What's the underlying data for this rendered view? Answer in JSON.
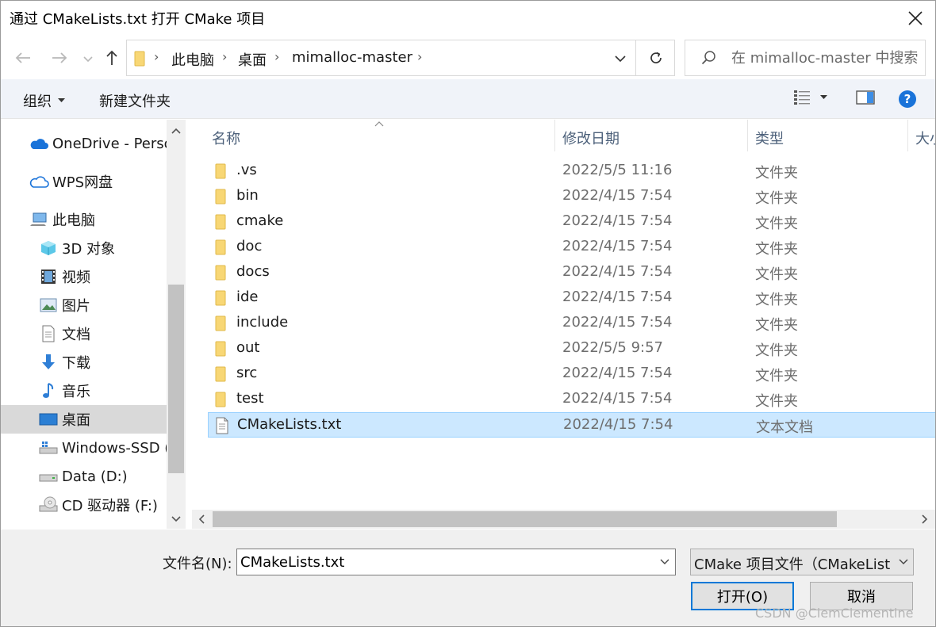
{
  "window": {
    "title": "通过 CMakeLists.txt 打开 CMake 项目"
  },
  "address": {
    "crumbs": [
      "此电脑",
      "桌面",
      "mimalloc-master"
    ],
    "search_placeholder": "在 mimalloc-master 中搜索"
  },
  "toolbar": {
    "organize_label": "组织",
    "new_folder_label": "新建文件夹"
  },
  "nav": {
    "items": [
      {
        "label": "OneDrive - Perso",
        "icon": "cloud-icon"
      },
      {
        "label": "WPS网盘",
        "icon": "cloud-outline-icon"
      },
      {
        "label": "此电脑",
        "icon": "computer-icon"
      },
      {
        "label": "3D 对象",
        "icon": "cube-icon"
      },
      {
        "label": "视频",
        "icon": "film-icon"
      },
      {
        "label": "图片",
        "icon": "picture-icon"
      },
      {
        "label": "文档",
        "icon": "document-icon"
      },
      {
        "label": "下载",
        "icon": "download-arrow-icon"
      },
      {
        "label": "音乐",
        "icon": "music-note-icon"
      },
      {
        "label": "桌面",
        "icon": "desktop-icon"
      },
      {
        "label": "Windows-SSD (",
        "icon": "windows-drive-icon"
      },
      {
        "label": "Data (D:)",
        "icon": "drive-icon"
      },
      {
        "label": "CD 驱动器 (F:)",
        "icon": "cd-drive-icon"
      }
    ]
  },
  "columns": {
    "name": "名称",
    "modified": "修改日期",
    "type": "类型",
    "size": "大小"
  },
  "files": [
    {
      "name": ".vs",
      "date": "2022/5/5 11:16",
      "type": "文件夹",
      "kind": "folder"
    },
    {
      "name": "bin",
      "date": "2022/4/15 7:54",
      "type": "文件夹",
      "kind": "folder"
    },
    {
      "name": "cmake",
      "date": "2022/4/15 7:54",
      "type": "文件夹",
      "kind": "folder"
    },
    {
      "name": "doc",
      "date": "2022/4/15 7:54",
      "type": "文件夹",
      "kind": "folder"
    },
    {
      "name": "docs",
      "date": "2022/4/15 7:54",
      "type": "文件夹",
      "kind": "folder"
    },
    {
      "name": "ide",
      "date": "2022/4/15 7:54",
      "type": "文件夹",
      "kind": "folder"
    },
    {
      "name": "include",
      "date": "2022/4/15 7:54",
      "type": "文件夹",
      "kind": "folder"
    },
    {
      "name": "out",
      "date": "2022/5/5 9:57",
      "type": "文件夹",
      "kind": "folder"
    },
    {
      "name": "src",
      "date": "2022/4/15 7:54",
      "type": "文件夹",
      "kind": "folder"
    },
    {
      "name": "test",
      "date": "2022/4/15 7:54",
      "type": "文件夹",
      "kind": "folder"
    },
    {
      "name": "CMakeLists.txt",
      "date": "2022/4/15 7:54",
      "type": "文本文档",
      "kind": "text"
    }
  ],
  "footer": {
    "filename_label": "文件名(N):",
    "filename_value": "CMakeLists.txt",
    "filetype_value": "CMake 项目文件（CMakeLists.txt）",
    "open_label": "打开(O)",
    "cancel_label": "取消",
    "watermark": "CSDN @ClemClementine"
  },
  "colors": {
    "selection_bg": "#cce8ff",
    "selection_border": "#99d1ff",
    "folder_yellow": "#f8d775",
    "accent": "#0078d7"
  }
}
